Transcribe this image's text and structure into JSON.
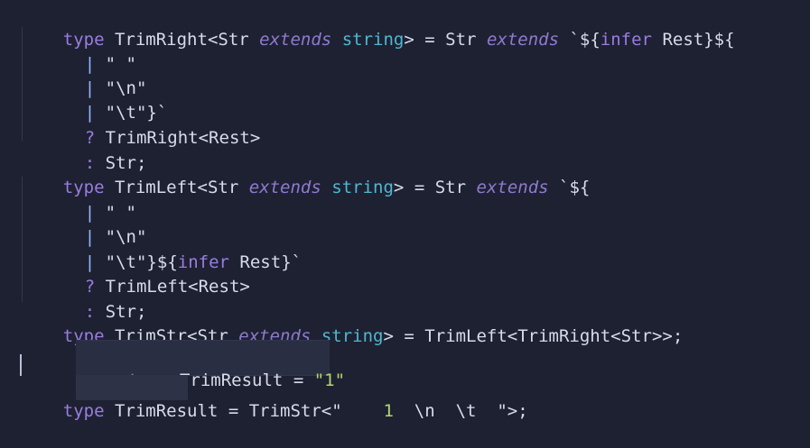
{
  "code": {
    "line1": {
      "type_kw": "type",
      "name": "TrimRight",
      "lt": "<",
      "param": "Str",
      "extends_kw": "extends",
      "constraint": "string",
      "gt": ">",
      "eq": "=",
      "lhs": "Str",
      "extends_kw2": "extends",
      "template_start": "`${",
      "infer_kw": "infer",
      "rest": "Rest",
      "template_end": "}${"
    },
    "line2": {
      "pipe": "|",
      "value": "\" \""
    },
    "line3": {
      "pipe": "|",
      "value": "\"\\n\""
    },
    "line4": {
      "pipe": "|",
      "value": "\"\\t\"}`"
    },
    "line5": {
      "q": "?",
      "call": "TrimRight<Rest>"
    },
    "line6": {
      "colon": ":",
      "value": "Str;"
    },
    "line7": {
      "type_kw": "type",
      "name": "TrimLeft",
      "lt": "<",
      "param": "Str",
      "extends_kw": "extends",
      "constraint": "string",
      "gt": ">",
      "eq": "=",
      "lhs": "Str",
      "extends_kw2": "extends",
      "template_start": "`${"
    },
    "line8": {
      "pipe": "|",
      "value": "\" \""
    },
    "line9": {
      "pipe": "|",
      "value": "\"\\n\""
    },
    "line10": {
      "pipe": "|",
      "value_start": "\"\\t\"}",
      "template_inner": "${",
      "infer_kw": "infer",
      "rest": "Rest",
      "template_close": "}`"
    },
    "line11": {
      "q": "?",
      "call": "TrimLeft<Rest>"
    },
    "line12": {
      "colon": ":",
      "value": "Str;"
    },
    "line13": {
      "type_kw": "type",
      "name": "TrimStr",
      "lt": "<",
      "param": "Str",
      "extends_kw": "extends",
      "constraint": "string",
      "gt": ">",
      "eq": "=",
      "rhs": "TrimLeft<TrimRight<Str>>;"
    },
    "hover": {
      "type_kw": "type",
      "name": "TrimResult",
      "eq": "=",
      "value": "\"1\""
    },
    "line14": {
      "type_kw": "type",
      "name": "TrimResult",
      "eq": "=",
      "call": "TrimStr<\"",
      "num": "1",
      "newline": "\\n",
      "tab": "\\t",
      "end": "\">;"
    }
  }
}
